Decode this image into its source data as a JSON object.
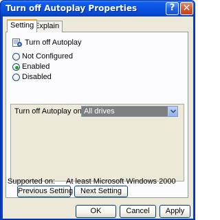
{
  "window": {
    "title": "Turn off Autoplay Properties",
    "help_glyph": "?",
    "close_glyph": "✕"
  },
  "tabs": [
    {
      "label": "Setting",
      "active": true
    },
    {
      "label": "Explain",
      "active": false
    }
  ],
  "policy": {
    "icon": "policy-setting-icon",
    "name": "Turn off Autoplay"
  },
  "radios": [
    {
      "label": "Not Configured",
      "checked": false
    },
    {
      "label": "Enabled",
      "checked": true
    },
    {
      "label": "Disabled",
      "checked": false
    }
  ],
  "options": {
    "label": "Turn off Autoplay on:",
    "selected": "All drives"
  },
  "supported": {
    "label": "Supported on:",
    "value": "At least Microsoft Windows 2000"
  },
  "buttons": {
    "previous": "Previous Setting",
    "next": "Next Setting",
    "ok": "OK",
    "cancel": "Cancel",
    "apply": "Apply"
  },
  "colors": {
    "titlebar": "#0a53e0",
    "dialog_bg": "#ece9d8",
    "tab_active_accent": "#f2a43a",
    "radio_checked": "#21a121"
  }
}
